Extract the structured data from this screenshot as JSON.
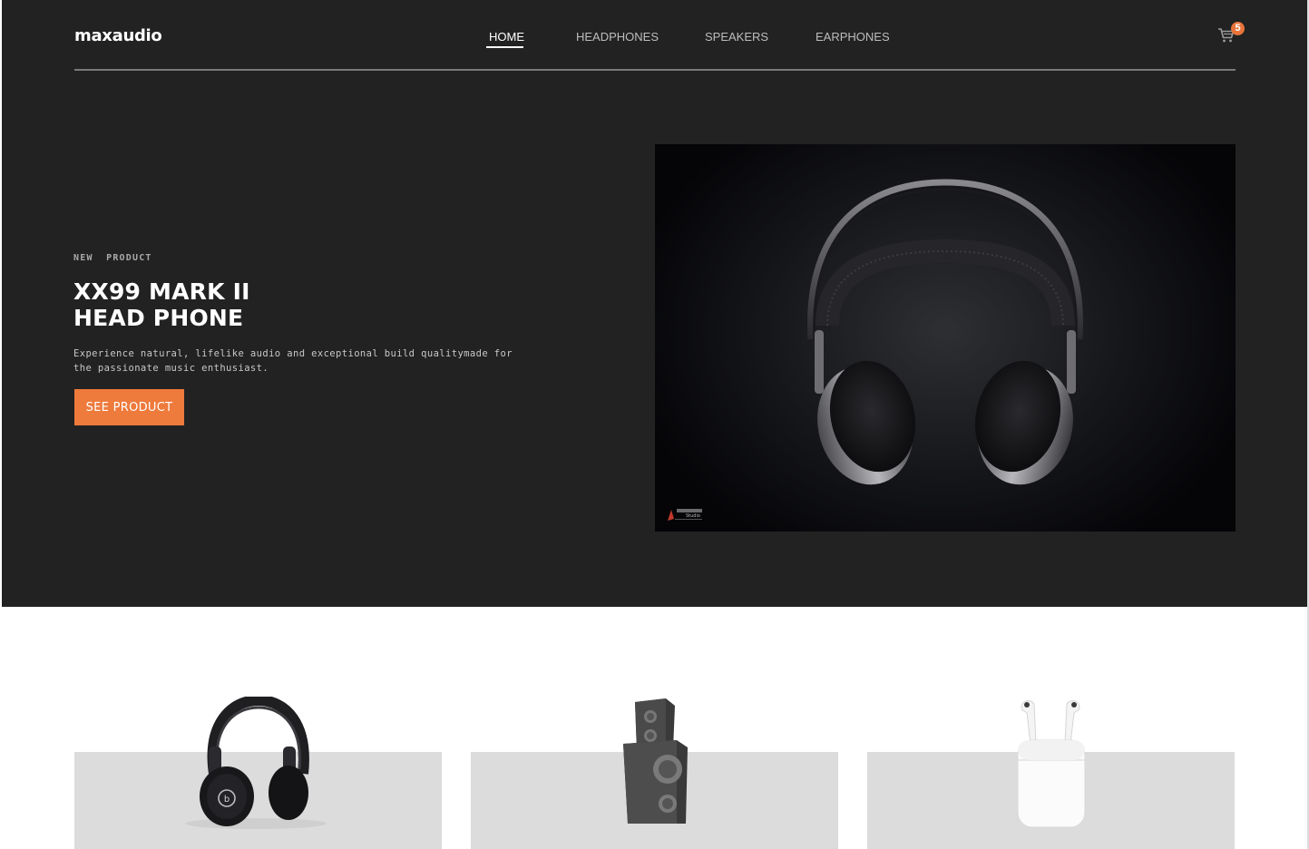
{
  "brand": {
    "logo": "maxaudio"
  },
  "nav": {
    "items": [
      {
        "label": "HOME",
        "active": true
      },
      {
        "label": "HEADPHONES",
        "active": false
      },
      {
        "label": "SPEAKERS",
        "active": false
      },
      {
        "label": "EARPHONES",
        "active": false
      }
    ]
  },
  "cart": {
    "count": "5",
    "icon": "cart-icon"
  },
  "hero": {
    "eyebrow": "NEW  PRODUCT",
    "title_line1": "XX99 MARK II",
    "title_line2": "HEAD PHONE",
    "description": "Experience natural, lifelike audio and exceptional build qualitymade for the passionate music enthusiast.",
    "cta_label": "SEE PRODUCT",
    "image": "headphones-photo",
    "watermark": "Studio"
  },
  "categories": [
    {
      "image": "headphones-product"
    },
    {
      "image": "speaker-product"
    },
    {
      "image": "earbuds-product"
    }
  ],
  "colors": {
    "dark_bg": "#222222",
    "accent": "#ee7a3c",
    "card_bg": "#dddcdc"
  }
}
